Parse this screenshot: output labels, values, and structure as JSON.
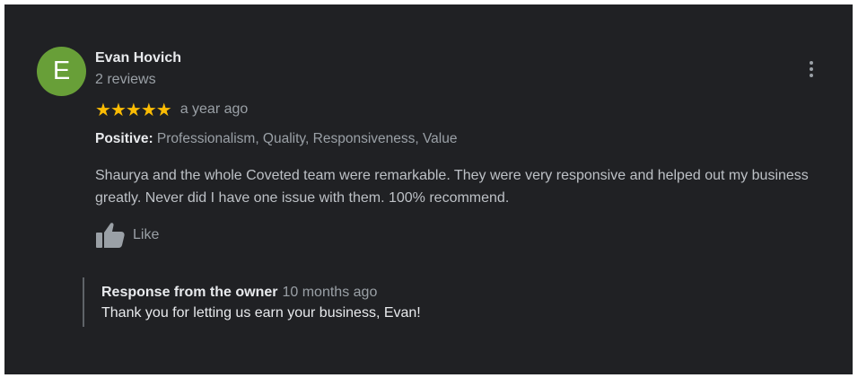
{
  "review": {
    "author": {
      "initial": "E",
      "name": "Evan Hovich",
      "meta": "2 reviews",
      "avatar_color": "#689f38"
    },
    "rating": 5,
    "rating_max": 5,
    "stars": [
      "★",
      "★",
      "★",
      "★",
      "★"
    ],
    "star_color": "#fbbc04",
    "date": "a year ago",
    "attributes": {
      "label": "Positive:",
      "values": "Professionalism, Quality, Responsiveness, Value"
    },
    "text": "Shaurya and the whole Coveted team were remarkable. They were very responsive and helped out my business greatly. Never did I have one issue with them. 100% recommend.",
    "like_label": "Like",
    "icons": {
      "more": "more-vert-icon",
      "like": "thumbs-up-icon"
    }
  },
  "owner_response": {
    "label": "Response from the owner",
    "date": "10 months ago",
    "text": "Thank you for letting us earn your business, Evan!"
  },
  "theme": {
    "background": "#202124"
  }
}
